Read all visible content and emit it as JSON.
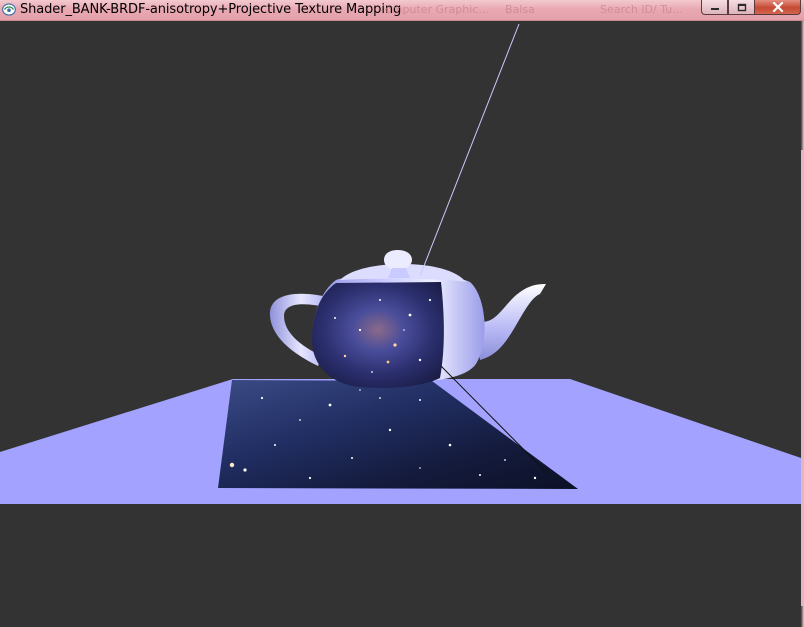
{
  "window": {
    "title": "Shader_BANK-BRDF-anisotropy+Projective Texture Mapping",
    "background_ghost_tabs": [
      "omputer Graphic...",
      "Balsa",
      "Search ID/ Tu..."
    ]
  },
  "controls": {
    "minimize": "minimize-icon",
    "maximize": "maximize-icon",
    "close": "close-icon"
  },
  "scene": {
    "background_color": "#333333",
    "floor_color": "#a3a3ff",
    "teapot_color": "#a9abf0",
    "projected_texture": "starfield nebula",
    "frustum_line_color": "#c9c9ff"
  }
}
